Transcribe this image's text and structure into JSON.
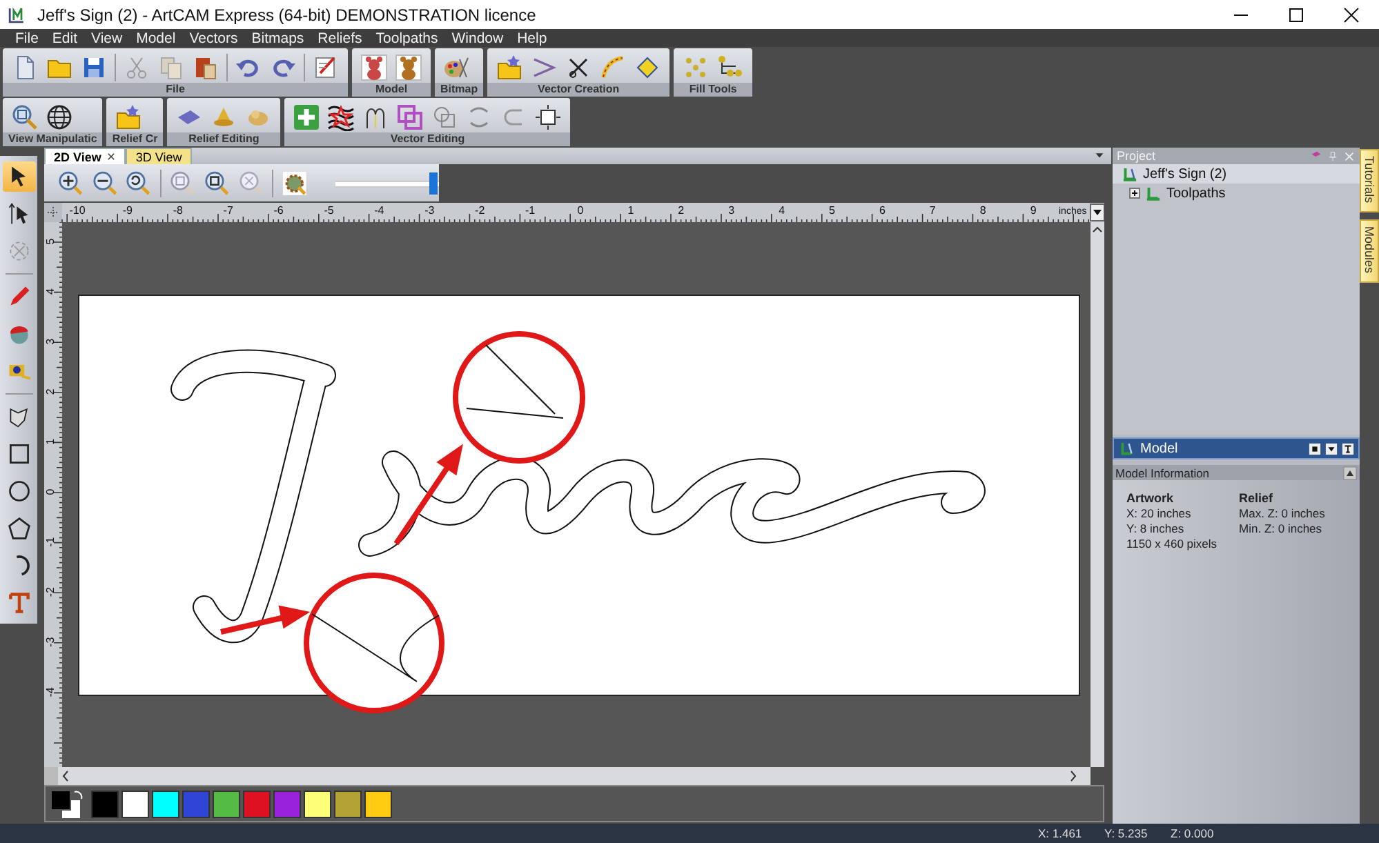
{
  "window": {
    "title": "Jeff's Sign (2) - ArtCAM Express (64-bit) DEMONSTRATION licence"
  },
  "menu": [
    "File",
    "Edit",
    "View",
    "Model",
    "Vectors",
    "Bitmaps",
    "Reliefs",
    "Toolpaths",
    "Window",
    "Help"
  ],
  "toolbar_rows": [
    {
      "toolbars": [
        {
          "label": "File"
        },
        {
          "label": "Model"
        },
        {
          "label": "Bitmap"
        },
        {
          "label": "Vector Creation"
        },
        {
          "label": "Fill Tools"
        }
      ]
    },
    {
      "toolbars": [
        {
          "label": "View Manipulatic"
        },
        {
          "label": "Relief Cr"
        },
        {
          "label": "Relief Editing"
        },
        {
          "label": "Vector Editing"
        }
      ]
    }
  ],
  "tools": [
    {
      "selected": true
    },
    {
      "selected": false
    },
    {
      "selected": false
    },
    {
      "selected": false
    },
    {
      "selected": false
    },
    {
      "selected": false
    },
    {
      "selected": false
    },
    {
      "selected": false
    },
    {
      "selected": false
    },
    {
      "selected": false
    },
    {
      "selected": false
    },
    {
      "selected": false
    }
  ],
  "view_tabs": [
    {
      "label": "2D View",
      "selected": true
    },
    {
      "label": "3D View",
      "selected": false
    }
  ],
  "view_toolbar": {
    "zoom_slider": {
      "level": 0.95
    }
  },
  "ruler": {
    "horizontal": [
      "-10",
      "-9",
      "-8",
      "-7",
      "-6",
      "-5",
      "-4",
      "-3",
      "-2",
      "-1",
      "0",
      "1",
      "2",
      "3",
      "4",
      "5",
      "6",
      "7",
      "8",
      "9"
    ],
    "unit": "inches",
    "vertical": [
      "5",
      "4",
      "3",
      "2",
      "1",
      "0",
      "-1",
      "-2",
      "-3",
      "-4"
    ]
  },
  "palette": [
    {
      "color": "#000000"
    },
    {
      "color": "#ffffff"
    },
    {
      "color": "#00ffff"
    },
    {
      "color": "#2e45d6"
    },
    {
      "color": "#55bb44"
    },
    {
      "color": "#dd1122"
    },
    {
      "color": "#9922dd"
    },
    {
      "color": "#ffff77"
    },
    {
      "color": "#b3a234"
    },
    {
      "color": "#ffcc11"
    }
  ],
  "project": {
    "title": "Project",
    "tree": [
      {
        "label": "Jeff's Sign (2)",
        "selected": true,
        "children": [
          {
            "label": "Toolpaths",
            "expanded": false
          }
        ]
      }
    ]
  },
  "model": {
    "title": "Model",
    "section": "Model Information",
    "columns": [
      {
        "heading": "Artwork",
        "lines": [
          "X: 20 inches",
          "Y: 8 inches",
          "1150 x 460 pixels"
        ]
      },
      {
        "heading": "Relief",
        "lines": [
          "Max. Z: 0 inches",
          "Min. Z: 0 inches"
        ]
      }
    ]
  },
  "side_tabs": [
    "Tutorials",
    "Modules"
  ],
  "status_bar": [
    "X: 1.461",
    "Y: 5.235",
    "Z: 0.000"
  ]
}
